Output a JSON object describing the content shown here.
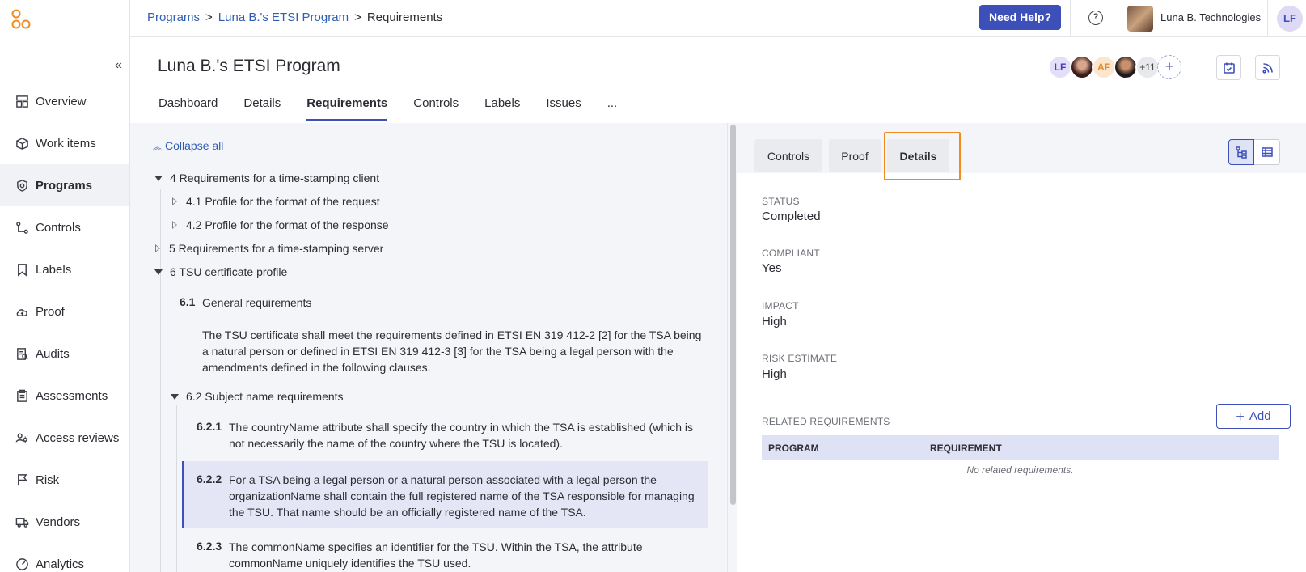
{
  "colors": {
    "accent": "#3d4fb8",
    "link": "#2f5db3",
    "focus": "#f28a1e"
  },
  "sidebar": {
    "items": [
      {
        "label": "Overview",
        "icon": "overview-icon"
      },
      {
        "label": "Work items",
        "icon": "box-icon"
      },
      {
        "label": "Programs",
        "icon": "shield-icon",
        "active": true
      },
      {
        "label": "Controls",
        "icon": "controls-icon"
      },
      {
        "label": "Labels",
        "icon": "label-icon"
      },
      {
        "label": "Proof",
        "icon": "cloud-icon"
      },
      {
        "label": "Audits",
        "icon": "audit-icon"
      },
      {
        "label": "Assessments",
        "icon": "clipboard-icon"
      },
      {
        "label": "Access reviews",
        "icon": "access-icon"
      },
      {
        "label": "Risk",
        "icon": "flag-icon"
      },
      {
        "label": "Vendors",
        "icon": "truck-icon"
      },
      {
        "label": "Analytics",
        "icon": "gauge-icon"
      }
    ]
  },
  "breadcrumb": {
    "root": "Programs",
    "program": "Luna B.'s ETSI Program",
    "current": "Requirements"
  },
  "topbar": {
    "help_label": "Need Help?",
    "org_name": "Luna B. Technologies",
    "user_initials": "LF"
  },
  "header": {
    "title": "Luna B.'s ETSI Program",
    "members": {
      "m1": "LF",
      "m3": "AF",
      "more": "+11",
      "add": "+"
    }
  },
  "tabs": [
    {
      "label": "Dashboard"
    },
    {
      "label": "Details"
    },
    {
      "label": "Requirements",
      "active": true
    },
    {
      "label": "Controls"
    },
    {
      "label": "Labels"
    },
    {
      "label": "Issues"
    },
    {
      "label": "..."
    }
  ],
  "tree": {
    "collapse_all": "Collapse all",
    "n4": "4 Requirements for a time-stamping client",
    "n41": "4.1 Profile for the format of the request",
    "n42": "4.2 Profile for the format of the response",
    "n5": "5 Requirements for a time-stamping server",
    "n6": "6 TSU certificate profile",
    "r61_num": "6.1",
    "r61_title": "General requirements",
    "r61_text": "The TSU certificate shall meet the requirements defined in ETSI EN 319 412-2 [2] for the TSA being a natural person or defined in ETSI EN 319 412-3 [3] for the TSA being a legal person with the amendments defined in the following clauses.",
    "n62": "6.2 Subject name requirements",
    "r621_num": "6.2.1",
    "r621_text": "The countryName attribute shall specify the country in which the TSA is established (which is not necessarily the name of the country where the TSU is located).",
    "r622_num": "6.2.2",
    "r622_text": "For a TSA being a legal person or a natural person associated with a legal person the organizationName shall contain the full registered name of the TSA responsible for managing the TSU. That name should be an officially registered name of the TSA.",
    "r623_num": "6.2.3",
    "r623_text": "The commonName specifies an identifier for the TSU. Within the TSA, the attribute commonName uniquely identifies the TSU used."
  },
  "detail": {
    "tabs": {
      "controls": "Controls",
      "proof": "Proof",
      "details": "Details"
    },
    "status_label": "STATUS",
    "status_value": "Completed",
    "compliant_label": "COMPLIANT",
    "compliant_value": "Yes",
    "impact_label": "IMPACT",
    "impact_value": "High",
    "risk_label": "RISK ESTIMATE",
    "risk_value": "High",
    "related_label": "RELATED REQUIREMENTS",
    "add_label": "Add",
    "col_program": "PROGRAM",
    "col_requirement": "REQUIREMENT",
    "empty": "No related requirements."
  }
}
